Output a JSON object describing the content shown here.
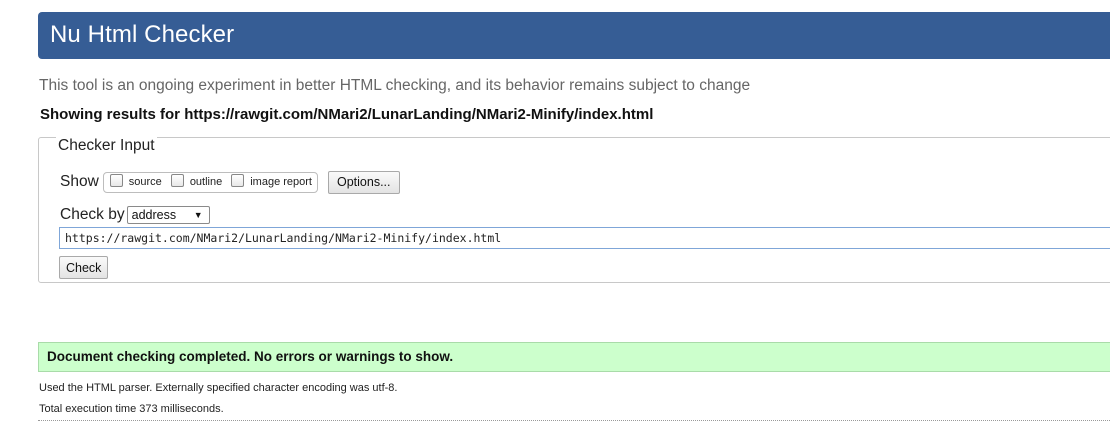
{
  "header": {
    "title": "Nu Html Checker"
  },
  "tagline": "This tool is an ongoing experiment in better HTML checking, and its behavior remains subject to change",
  "showing": {
    "prefix": "Showing results for ",
    "url": "https://rawgit.com/NMari2/LunarLanding/NMari2-Minify/index.html"
  },
  "checker_input": {
    "legend": "Checker Input",
    "show_label": "Show",
    "checkboxes": [
      {
        "label": "source",
        "checked": false
      },
      {
        "label": "outline",
        "checked": false
      },
      {
        "label": "image report",
        "checked": false
      }
    ],
    "options_button": "Options...",
    "check_by_label": "Check by",
    "check_by_value": "address",
    "url_value": "https://rawgit.com/NMari2/LunarLanding/NMari2-Minify/index.html",
    "check_button": "Check"
  },
  "result": {
    "message": "Document checking completed. No errors or warnings to show.",
    "parser_note": "Used the HTML parser. Externally specified character encoding was utf-8.",
    "execution_time": "Total execution time 373 milliseconds."
  },
  "colors": {
    "header_bg": "#365d95",
    "success_bg": "#ccffcc",
    "tagline_text": "#666666"
  }
}
